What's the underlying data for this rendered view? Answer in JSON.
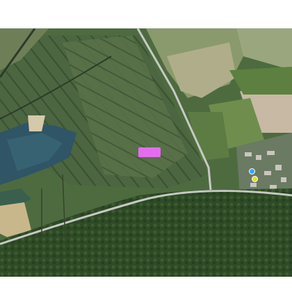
{
  "map": {
    "view": "satellite",
    "labels": {
      "label_a": "",
      "label_b": "",
      "label_c": ""
    },
    "markers": [
      {
        "name": "blue-marker",
        "color": "#3aa2ff"
      },
      {
        "name": "yellow-marker",
        "color": "#e4df2d"
      }
    ],
    "label_colors": {
      "blue": "#1f6fd6",
      "pink": "#e46cf0"
    }
  },
  "footer": {
    "credit": ""
  }
}
